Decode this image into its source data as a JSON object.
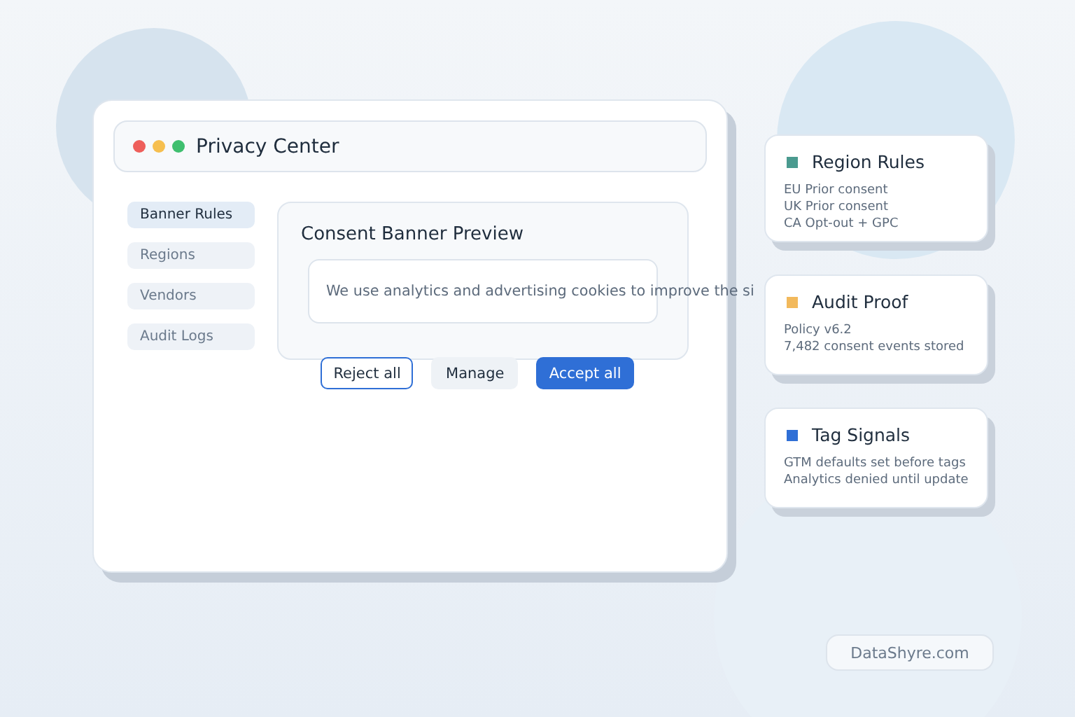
{
  "window": {
    "title": "Privacy Center"
  },
  "sidebar": {
    "items": [
      {
        "label": "Banner Rules",
        "selected": true
      },
      {
        "label": "Regions",
        "selected": false
      },
      {
        "label": "Vendors",
        "selected": false
      },
      {
        "label": "Audit Logs",
        "selected": false
      }
    ]
  },
  "preview": {
    "title": "Consent Banner Preview",
    "message": "We use analytics and advertising cookies to improve the si",
    "buttons": [
      {
        "label": "Reject all",
        "kind": "outline"
      },
      {
        "label": "Manage",
        "kind": "secondary"
      },
      {
        "label": "Accept all",
        "kind": "primary"
      }
    ]
  },
  "cards": [
    {
      "title": "Region Rules",
      "color": "#4a9a8f",
      "lines": [
        "EU  Prior consent",
        "UK  Prior consent",
        "CA  Opt-out + GPC"
      ]
    },
    {
      "title": "Audit Proof",
      "color": "#f2b95c",
      "lines": [
        "Policy v6.2",
        "7,482 consent events stored"
      ]
    },
    {
      "title": "Tag Signals",
      "color": "#2f6fd6",
      "lines": [
        "GTM defaults set before tags",
        "Analytics denied until update"
      ]
    }
  ],
  "footer": {
    "brand": "DataShyre.com"
  }
}
